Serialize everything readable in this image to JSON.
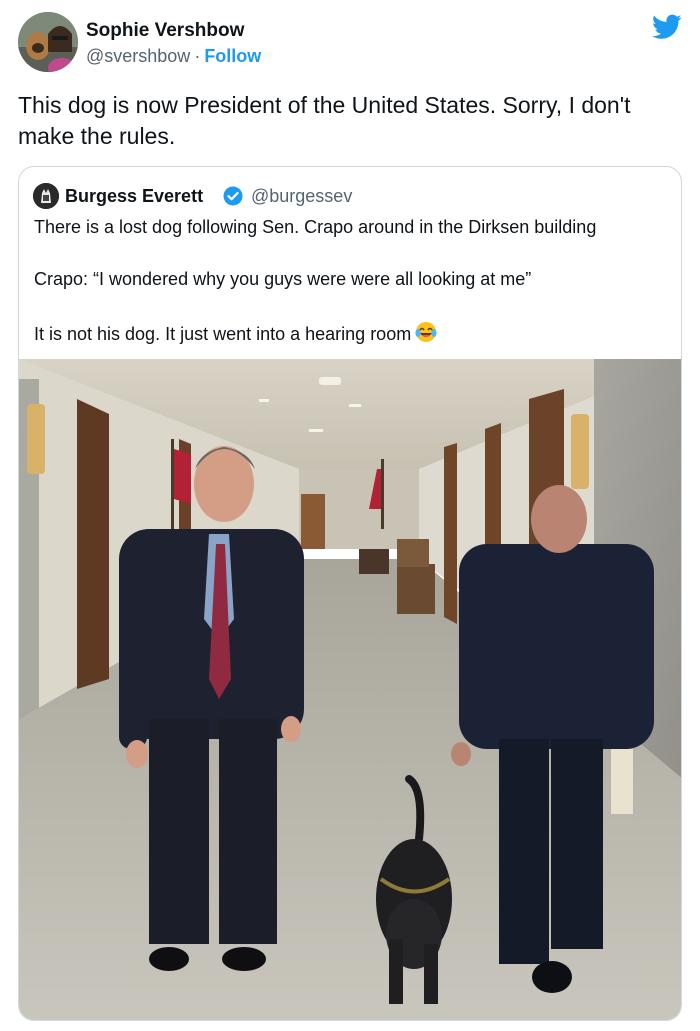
{
  "author": {
    "name": "Sophie Vershbow",
    "handle": "@svershbow",
    "separator": "·",
    "follow_label": "Follow"
  },
  "tweet": {
    "text": "This dog is now President of the United States. Sorry, I don't make the rules."
  },
  "quoted": {
    "name": "Burgess Everett",
    "handle": "@burgessev",
    "line1": "There is a lost dog following Sen. Crapo around in the Dirksen building",
    "line2": "Crapo: “I wondered why you guys were were all looking at me”",
    "line3": "It is not his dog. It just went into a hearing room"
  },
  "icons": {
    "brand": "twitter-bird-icon",
    "verified": "verified-badge-icon",
    "emoji": "tears-of-joy-emoji"
  },
  "colors": {
    "accent": "#1d9bf0",
    "text": "#0f1419",
    "muted": "#536471",
    "border": "#cfd9de"
  }
}
